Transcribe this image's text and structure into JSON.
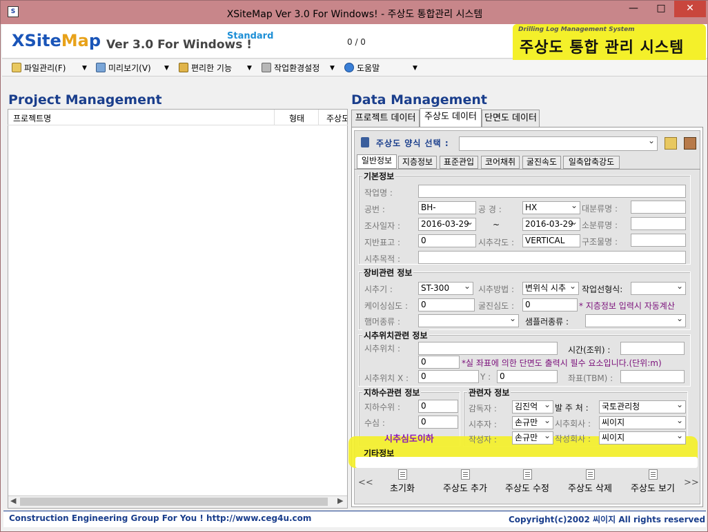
{
  "window": {
    "title": "XSiteMap Ver 3.0 For Windows! - 주상도 통합관리 시스템",
    "min": "—",
    "max": "□",
    "close": "✕"
  },
  "banner": {
    "logo_x": "X",
    "logo_site": "Site",
    "logo_ma": "Ma",
    "logo_p": "p",
    "version": "Ver 3.0 For Windows !",
    "edition": "Standard",
    "counter": "0 / 0",
    "system_en": "Drilling Log Management System",
    "system_kr": "주상도 통합 관리 시스템"
  },
  "menu": {
    "items": [
      {
        "label": "파일관리(F)",
        "icon": "folder-edit-icon"
      },
      {
        "label": "미리보기(V)",
        "icon": "preview-icon"
      },
      {
        "label": "편리한 기능",
        "icon": "box-icon"
      },
      {
        "label": "작업환경설정",
        "icon": "wrench-icon"
      },
      {
        "label": "도움말",
        "icon": "help-icon"
      }
    ]
  },
  "project": {
    "title": "Project Management",
    "columns": [
      "프로젝트명",
      "형태",
      "주상도"
    ]
  },
  "data": {
    "title": "Data Management",
    "tabs": [
      "프로젝트 데이터",
      "주상도 데이터",
      "단면도 데이터"
    ],
    "form_select_label": "주상도 양식 선택 :",
    "form_select_value": "",
    "sub_tabs": [
      "일반정보",
      "지층정보",
      "표준관입",
      "코어채취",
      "굴진속도",
      "일축압축강도"
    ]
  },
  "basic": {
    "title": "기본정보",
    "work_name_label": "작업명 :",
    "work_name": "",
    "hole_no_label": "공번 :",
    "hole_no": "BH-",
    "diameter_label": "공 경 :",
    "diameter": "HX",
    "major_class_label": "대분류명 :",
    "major_class": "",
    "survey_date_label": "조사일자 :",
    "date_from": "2016-03-29",
    "tilde": "~",
    "date_to": "2016-03-29",
    "minor_class_label": "소분류명 :",
    "minor_class": "",
    "ground_elev_label": "지반표고 :",
    "ground_elev": "0",
    "drill_angle_label": "시추각도 :",
    "drill_angle": "VERTICAL",
    "structure_label": "구조물명 :",
    "structure": "",
    "purpose_label": "시추목적 :",
    "purpose": ""
  },
  "equipment": {
    "title": "장비관련 정보",
    "drill_label": "시추기 :",
    "drill": "ST-300",
    "method_label": "시추방법 :",
    "method": "변위식 시추",
    "line_type_label": "작업선형식:",
    "line_type": "",
    "casing_label": "케이싱심도 :",
    "casing": "0",
    "boring_depth_label": "굴진심도 :",
    "boring_depth": "0",
    "auto_note": "* 지층정보 입력시 자동계산",
    "hammer_label": "햄머종류 :",
    "hammer": "",
    "sampler_label": "샘플러종류 :",
    "sampler": ""
  },
  "location": {
    "title": "시추위치관련 정보",
    "position_label": "시추위치 :",
    "position": "",
    "time_label": "시간(조위) :",
    "time": "",
    "scale_value": "0",
    "scale_note": "*실 좌표에 의한 단면도 출력시 필수 요소입니다.(단위:m)",
    "x_label": "시추위치 X :",
    "x": "0",
    "y_label": "Y :",
    "y": "0",
    "tbm_label": "좌표(TBM) :",
    "tbm": ""
  },
  "groundwater": {
    "title": "지하수관련 정보",
    "level_label": "지하수위 :",
    "level": "0",
    "depth_label": "수심 :",
    "depth": "0",
    "below_label": "시추심도이하"
  },
  "manager": {
    "title": "관련자 정보",
    "supervisor_label": "감독자 :",
    "supervisor": "김진억",
    "client_label": "발 주 처 :",
    "client": "국토관리청",
    "driller_label": "시추자 :",
    "driller": "손규만",
    "drill_company_label": "시추회사 :",
    "drill_company": "씨이지",
    "writer_label": "작성자 :",
    "writer": "손규만",
    "writer_company_label": "작성회사 :",
    "writer_company": "씨이지"
  },
  "etc": {
    "title": "기타정보"
  },
  "actions": {
    "prev": "<<",
    "next": ">>",
    "reset": "초기화",
    "add": "주상도 추가",
    "edit": "주상도 수정",
    "delete": "주상도 삭제",
    "view": "주상도 보기"
  },
  "status": {
    "left": "Construction Engineering Group For You ! http://www.ceg4u.com",
    "right": "Copyright(c)2002 씨이지 All rights reserved"
  }
}
